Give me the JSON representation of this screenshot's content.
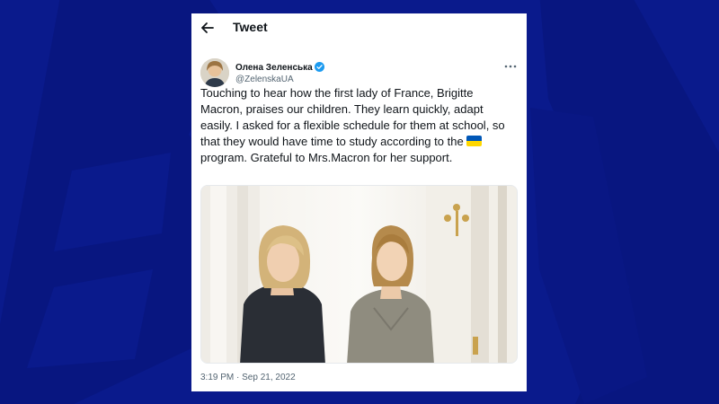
{
  "header": {
    "title": "Tweet",
    "back_icon": "arrow-left-icon"
  },
  "author": {
    "name": "Олена Зеленська",
    "handle": "@ZelenskaUA",
    "verified_icon": "verified-badge-icon",
    "more_icon": "more-options-icon"
  },
  "tweet": {
    "text_before_flag": "Touching to hear how the first lady of France, Brigitte Macron, praises our children. They learn quickly, adapt easily. I asked for a flexible schedule for them at school, so that they would have time to study according to the ",
    "flag_icon": "ukraine-flag-icon",
    "text_after_flag": " program. Grateful to Mrs.Macron for her support.",
    "timestamp": "3:19 PM · Sep 21, 2022"
  },
  "colors": {
    "background": "#0a1a8c",
    "verified": "#1d9bf0",
    "flag_blue": "#0057b7",
    "flag_yellow": "#ffd700"
  }
}
